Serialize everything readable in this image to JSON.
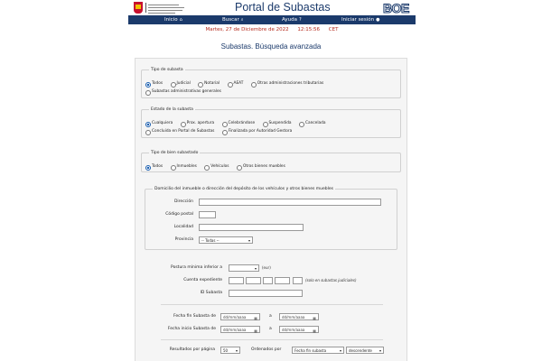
{
  "header": {
    "title": "Portal de Subastas",
    "boe_logo": "BOE",
    "colors": {
      "navy": "#1b3a6b",
      "date_red": "#b52a1c",
      "shield_red": "#c8102e",
      "shield_gold": "#f2c200"
    }
  },
  "nav": {
    "inicio": "Inicio",
    "inicio_icon": "home-icon",
    "buscar": "Buscar",
    "buscar_icon": "search-icon",
    "ayuda": "Ayuda",
    "ayuda_icon": "help-icon",
    "login": "Iniciar sesión",
    "login_icon": "user-icon"
  },
  "datebar": {
    "date": "Martes, 27 de Diciembre de 2022",
    "time": "12:15:56",
    "tz": "CET"
  },
  "page_title": "Subastas. Búsqueda avanzada",
  "tipo_subasta": {
    "legend": "Tipo de subasta",
    "options": [
      "Todos",
      "Judicial",
      "Notarial",
      "AEAT",
      "Otras administraciones tributarias",
      "Subastas administrativas generales"
    ],
    "selected": "Todos"
  },
  "estado": {
    "legend": "Estado de la subasta",
    "options": [
      "Cualquiera",
      "Prox. apertura",
      "Celebrándose",
      "Suspendida",
      "Cancelada",
      "Concluida en Portal de Subastas",
      "Finalizada por Autoridad Gestora"
    ],
    "selected": "Cualquiera"
  },
  "tipo_bien": {
    "legend": "Tipo de bien subastado",
    "options": [
      "Todos",
      "Inmuebles",
      "Vehículos",
      "Otros bienes muebles"
    ],
    "selected": "Todos"
  },
  "domicilio": {
    "legend": "Domicilio del inmueble o dirección del depósito de los vehículos y otros bienes muebles",
    "direccion_label": "Dirección",
    "cp_label": "Código postal",
    "localidad_label": "Localidad",
    "provincia_label": "Provincia",
    "provincia_value": "-- Todas --"
  },
  "postura": {
    "label": "Postura mínima inferior a",
    "unit": "(eur)"
  },
  "cuenta": {
    "label": "Cuenta expediente",
    "note": "(solo en subastas judiciales)"
  },
  "id_subasta": {
    "label": "ID Subasta"
  },
  "fechas": {
    "fin_label": "Fecha fin Subasta de",
    "inicio_label": "Fecha inicio Subasta de",
    "placeholder": "dd/mm/aaaa",
    "a_label": "a"
  },
  "resultados": {
    "label": "Resultados por página",
    "value": "50",
    "orden_label": "Ordenados por",
    "orden_value": "Fecha fin subasta",
    "direccion_value": "descendente"
  }
}
